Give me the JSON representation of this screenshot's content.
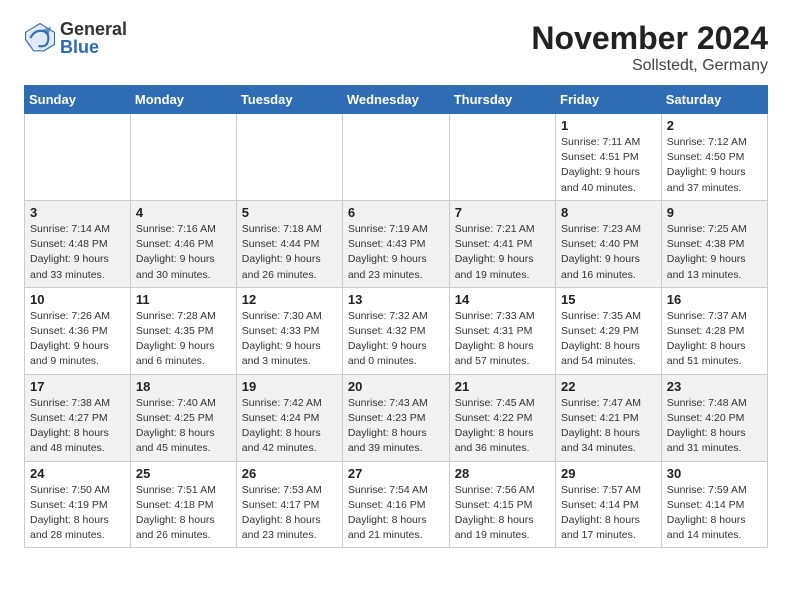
{
  "header": {
    "logo_general": "General",
    "logo_blue": "Blue",
    "month_title": "November 2024",
    "location": "Sollstedt, Germany"
  },
  "days_of_week": [
    "Sunday",
    "Monday",
    "Tuesday",
    "Wednesday",
    "Thursday",
    "Friday",
    "Saturday"
  ],
  "weeks": [
    [
      {
        "day": "",
        "info": ""
      },
      {
        "day": "",
        "info": ""
      },
      {
        "day": "",
        "info": ""
      },
      {
        "day": "",
        "info": ""
      },
      {
        "day": "",
        "info": ""
      },
      {
        "day": "1",
        "info": "Sunrise: 7:11 AM\nSunset: 4:51 PM\nDaylight: 9 hours and 40 minutes."
      },
      {
        "day": "2",
        "info": "Sunrise: 7:12 AM\nSunset: 4:50 PM\nDaylight: 9 hours and 37 minutes."
      }
    ],
    [
      {
        "day": "3",
        "info": "Sunrise: 7:14 AM\nSunset: 4:48 PM\nDaylight: 9 hours and 33 minutes."
      },
      {
        "day": "4",
        "info": "Sunrise: 7:16 AM\nSunset: 4:46 PM\nDaylight: 9 hours and 30 minutes."
      },
      {
        "day": "5",
        "info": "Sunrise: 7:18 AM\nSunset: 4:44 PM\nDaylight: 9 hours and 26 minutes."
      },
      {
        "day": "6",
        "info": "Sunrise: 7:19 AM\nSunset: 4:43 PM\nDaylight: 9 hours and 23 minutes."
      },
      {
        "day": "7",
        "info": "Sunrise: 7:21 AM\nSunset: 4:41 PM\nDaylight: 9 hours and 19 minutes."
      },
      {
        "day": "8",
        "info": "Sunrise: 7:23 AM\nSunset: 4:40 PM\nDaylight: 9 hours and 16 minutes."
      },
      {
        "day": "9",
        "info": "Sunrise: 7:25 AM\nSunset: 4:38 PM\nDaylight: 9 hours and 13 minutes."
      }
    ],
    [
      {
        "day": "10",
        "info": "Sunrise: 7:26 AM\nSunset: 4:36 PM\nDaylight: 9 hours and 9 minutes."
      },
      {
        "day": "11",
        "info": "Sunrise: 7:28 AM\nSunset: 4:35 PM\nDaylight: 9 hours and 6 minutes."
      },
      {
        "day": "12",
        "info": "Sunrise: 7:30 AM\nSunset: 4:33 PM\nDaylight: 9 hours and 3 minutes."
      },
      {
        "day": "13",
        "info": "Sunrise: 7:32 AM\nSunset: 4:32 PM\nDaylight: 9 hours and 0 minutes."
      },
      {
        "day": "14",
        "info": "Sunrise: 7:33 AM\nSunset: 4:31 PM\nDaylight: 8 hours and 57 minutes."
      },
      {
        "day": "15",
        "info": "Sunrise: 7:35 AM\nSunset: 4:29 PM\nDaylight: 8 hours and 54 minutes."
      },
      {
        "day": "16",
        "info": "Sunrise: 7:37 AM\nSunset: 4:28 PM\nDaylight: 8 hours and 51 minutes."
      }
    ],
    [
      {
        "day": "17",
        "info": "Sunrise: 7:38 AM\nSunset: 4:27 PM\nDaylight: 8 hours and 48 minutes."
      },
      {
        "day": "18",
        "info": "Sunrise: 7:40 AM\nSunset: 4:25 PM\nDaylight: 8 hours and 45 minutes."
      },
      {
        "day": "19",
        "info": "Sunrise: 7:42 AM\nSunset: 4:24 PM\nDaylight: 8 hours and 42 minutes."
      },
      {
        "day": "20",
        "info": "Sunrise: 7:43 AM\nSunset: 4:23 PM\nDaylight: 8 hours and 39 minutes."
      },
      {
        "day": "21",
        "info": "Sunrise: 7:45 AM\nSunset: 4:22 PM\nDaylight: 8 hours and 36 minutes."
      },
      {
        "day": "22",
        "info": "Sunrise: 7:47 AM\nSunset: 4:21 PM\nDaylight: 8 hours and 34 minutes."
      },
      {
        "day": "23",
        "info": "Sunrise: 7:48 AM\nSunset: 4:20 PM\nDaylight: 8 hours and 31 minutes."
      }
    ],
    [
      {
        "day": "24",
        "info": "Sunrise: 7:50 AM\nSunset: 4:19 PM\nDaylight: 8 hours and 28 minutes."
      },
      {
        "day": "25",
        "info": "Sunrise: 7:51 AM\nSunset: 4:18 PM\nDaylight: 8 hours and 26 minutes."
      },
      {
        "day": "26",
        "info": "Sunrise: 7:53 AM\nSunset: 4:17 PM\nDaylight: 8 hours and 23 minutes."
      },
      {
        "day": "27",
        "info": "Sunrise: 7:54 AM\nSunset: 4:16 PM\nDaylight: 8 hours and 21 minutes."
      },
      {
        "day": "28",
        "info": "Sunrise: 7:56 AM\nSunset: 4:15 PM\nDaylight: 8 hours and 19 minutes."
      },
      {
        "day": "29",
        "info": "Sunrise: 7:57 AM\nSunset: 4:14 PM\nDaylight: 8 hours and 17 minutes."
      },
      {
        "day": "30",
        "info": "Sunrise: 7:59 AM\nSunset: 4:14 PM\nDaylight: 8 hours and 14 minutes."
      }
    ]
  ]
}
